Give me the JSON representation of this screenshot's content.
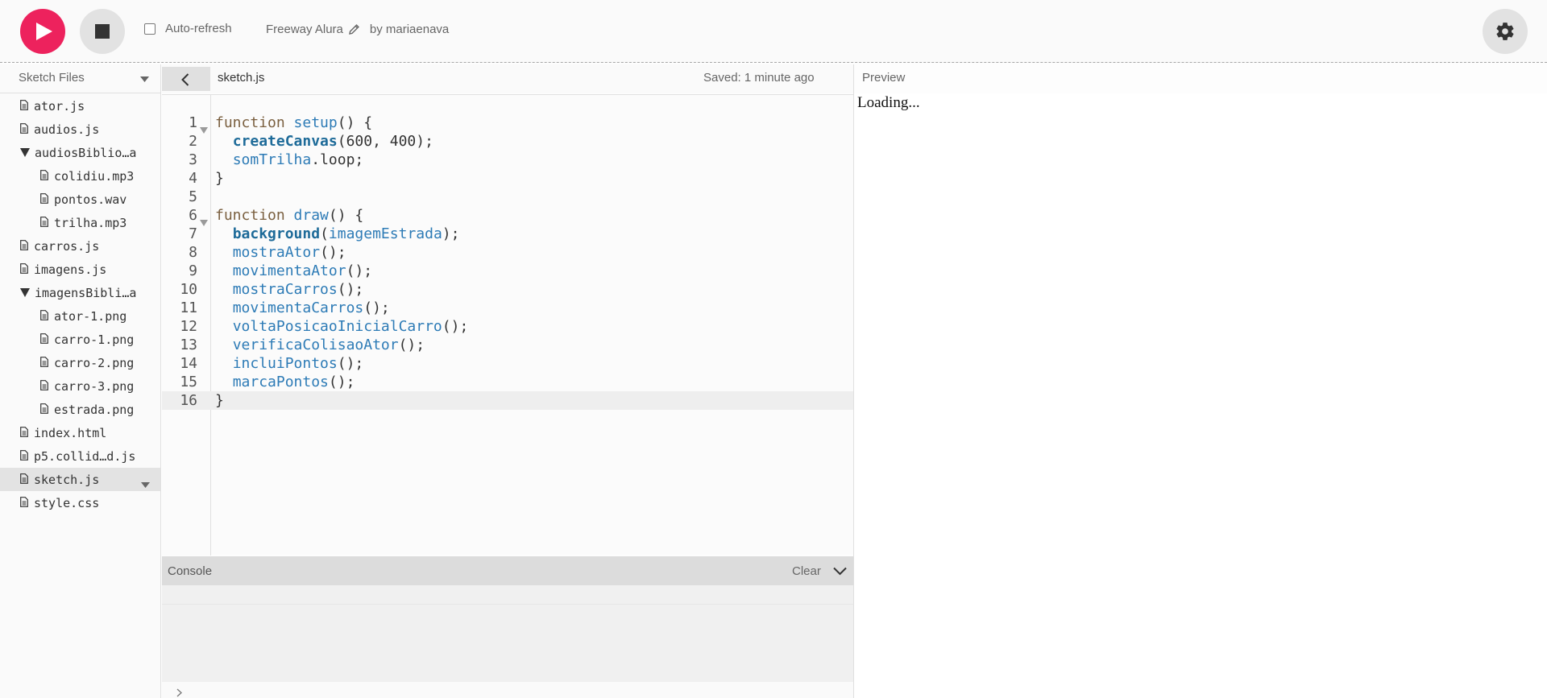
{
  "toolbar": {
    "auto_refresh_label": "Auto-refresh",
    "project_name": "Freeway Alura",
    "author": "by mariaenava",
    "accent_color": "#ed225d"
  },
  "sidebar": {
    "title": "Sketch Files",
    "files": [
      {
        "name": "ator.js",
        "type": "file",
        "level": 0
      },
      {
        "name": "audios.js",
        "type": "file",
        "level": 0
      },
      {
        "name": "audiosBiblio…a",
        "type": "folder",
        "level": 0
      },
      {
        "name": "colidiu.mp3",
        "type": "file",
        "level": 1
      },
      {
        "name": "pontos.wav",
        "type": "file",
        "level": 1
      },
      {
        "name": "trilha.mp3",
        "type": "file",
        "level": 1
      },
      {
        "name": "carros.js",
        "type": "file",
        "level": 0
      },
      {
        "name": "imagens.js",
        "type": "file",
        "level": 0
      },
      {
        "name": "imagensBibli…a",
        "type": "folder",
        "level": 0
      },
      {
        "name": "ator-1.png",
        "type": "file",
        "level": 1
      },
      {
        "name": "carro-1.png",
        "type": "file",
        "level": 1
      },
      {
        "name": "carro-2.png",
        "type": "file",
        "level": 1
      },
      {
        "name": "carro-3.png",
        "type": "file",
        "level": 1
      },
      {
        "name": "estrada.png",
        "type": "file",
        "level": 1
      },
      {
        "name": "index.html",
        "type": "file",
        "level": 0
      },
      {
        "name": "p5.collid…d.js",
        "type": "file",
        "level": 0
      },
      {
        "name": "sketch.js",
        "type": "file",
        "level": 0,
        "selected": true
      },
      {
        "name": "style.css",
        "type": "file",
        "level": 0
      }
    ]
  },
  "editor": {
    "filename": "sketch.js",
    "saved_status": "Saved: 1 minute ago",
    "active_line": 16,
    "lines": [
      {
        "n": "1",
        "fold": true,
        "tokens": [
          [
            "kw",
            "function"
          ],
          [
            "p",
            " "
          ],
          [
            "fn",
            "setup"
          ],
          [
            "p",
            "() {"
          ]
        ]
      },
      {
        "n": "2",
        "tokens": [
          [
            "p",
            "  "
          ],
          [
            "bi",
            "createCanvas"
          ],
          [
            "p",
            "(600, 400);"
          ]
        ]
      },
      {
        "n": "3",
        "tokens": [
          [
            "p",
            "  "
          ],
          [
            "vr",
            "somTrilha"
          ],
          [
            "p",
            ".loop;"
          ]
        ]
      },
      {
        "n": "4",
        "tokens": [
          [
            "p",
            "}"
          ]
        ]
      },
      {
        "n": "5",
        "tokens": []
      },
      {
        "n": "6",
        "fold": true,
        "tokens": [
          [
            "kw",
            "function"
          ],
          [
            "p",
            " "
          ],
          [
            "fn",
            "draw"
          ],
          [
            "p",
            "() {"
          ]
        ]
      },
      {
        "n": "7",
        "tokens": [
          [
            "p",
            "  "
          ],
          [
            "bi",
            "background"
          ],
          [
            "p",
            "("
          ],
          [
            "vr",
            "imagemEstrada"
          ],
          [
            "p",
            ");"
          ]
        ]
      },
      {
        "n": "8",
        "tokens": [
          [
            "p",
            "  "
          ],
          [
            "fn",
            "mostraAtor"
          ],
          [
            "p",
            "();"
          ]
        ]
      },
      {
        "n": "9",
        "tokens": [
          [
            "p",
            "  "
          ],
          [
            "fn",
            "movimentaAtor"
          ],
          [
            "p",
            "();"
          ]
        ]
      },
      {
        "n": "10",
        "tokens": [
          [
            "p",
            "  "
          ],
          [
            "fn",
            "mostraCarros"
          ],
          [
            "p",
            "();"
          ]
        ]
      },
      {
        "n": "11",
        "tokens": [
          [
            "p",
            "  "
          ],
          [
            "fn",
            "movimentaCarros"
          ],
          [
            "p",
            "();"
          ]
        ]
      },
      {
        "n": "12",
        "tokens": [
          [
            "p",
            "  "
          ],
          [
            "fn",
            "voltaPosicaoInicialCarro"
          ],
          [
            "p",
            "();"
          ]
        ]
      },
      {
        "n": "13",
        "tokens": [
          [
            "p",
            "  "
          ],
          [
            "fn",
            "verificaColisaoAtor"
          ],
          [
            "p",
            "();"
          ]
        ]
      },
      {
        "n": "14",
        "tokens": [
          [
            "p",
            "  "
          ],
          [
            "fn",
            "incluiPontos"
          ],
          [
            "p",
            "();"
          ]
        ]
      },
      {
        "n": "15",
        "tokens": [
          [
            "p",
            "  "
          ],
          [
            "fn",
            "marcaPontos"
          ],
          [
            "p",
            "();"
          ]
        ]
      },
      {
        "n": "16",
        "tokens": [
          [
            "p",
            "}"
          ]
        ]
      }
    ]
  },
  "console": {
    "title": "Console",
    "clear_label": "Clear"
  },
  "preview": {
    "title": "Preview",
    "loading_text": "Loading..."
  }
}
